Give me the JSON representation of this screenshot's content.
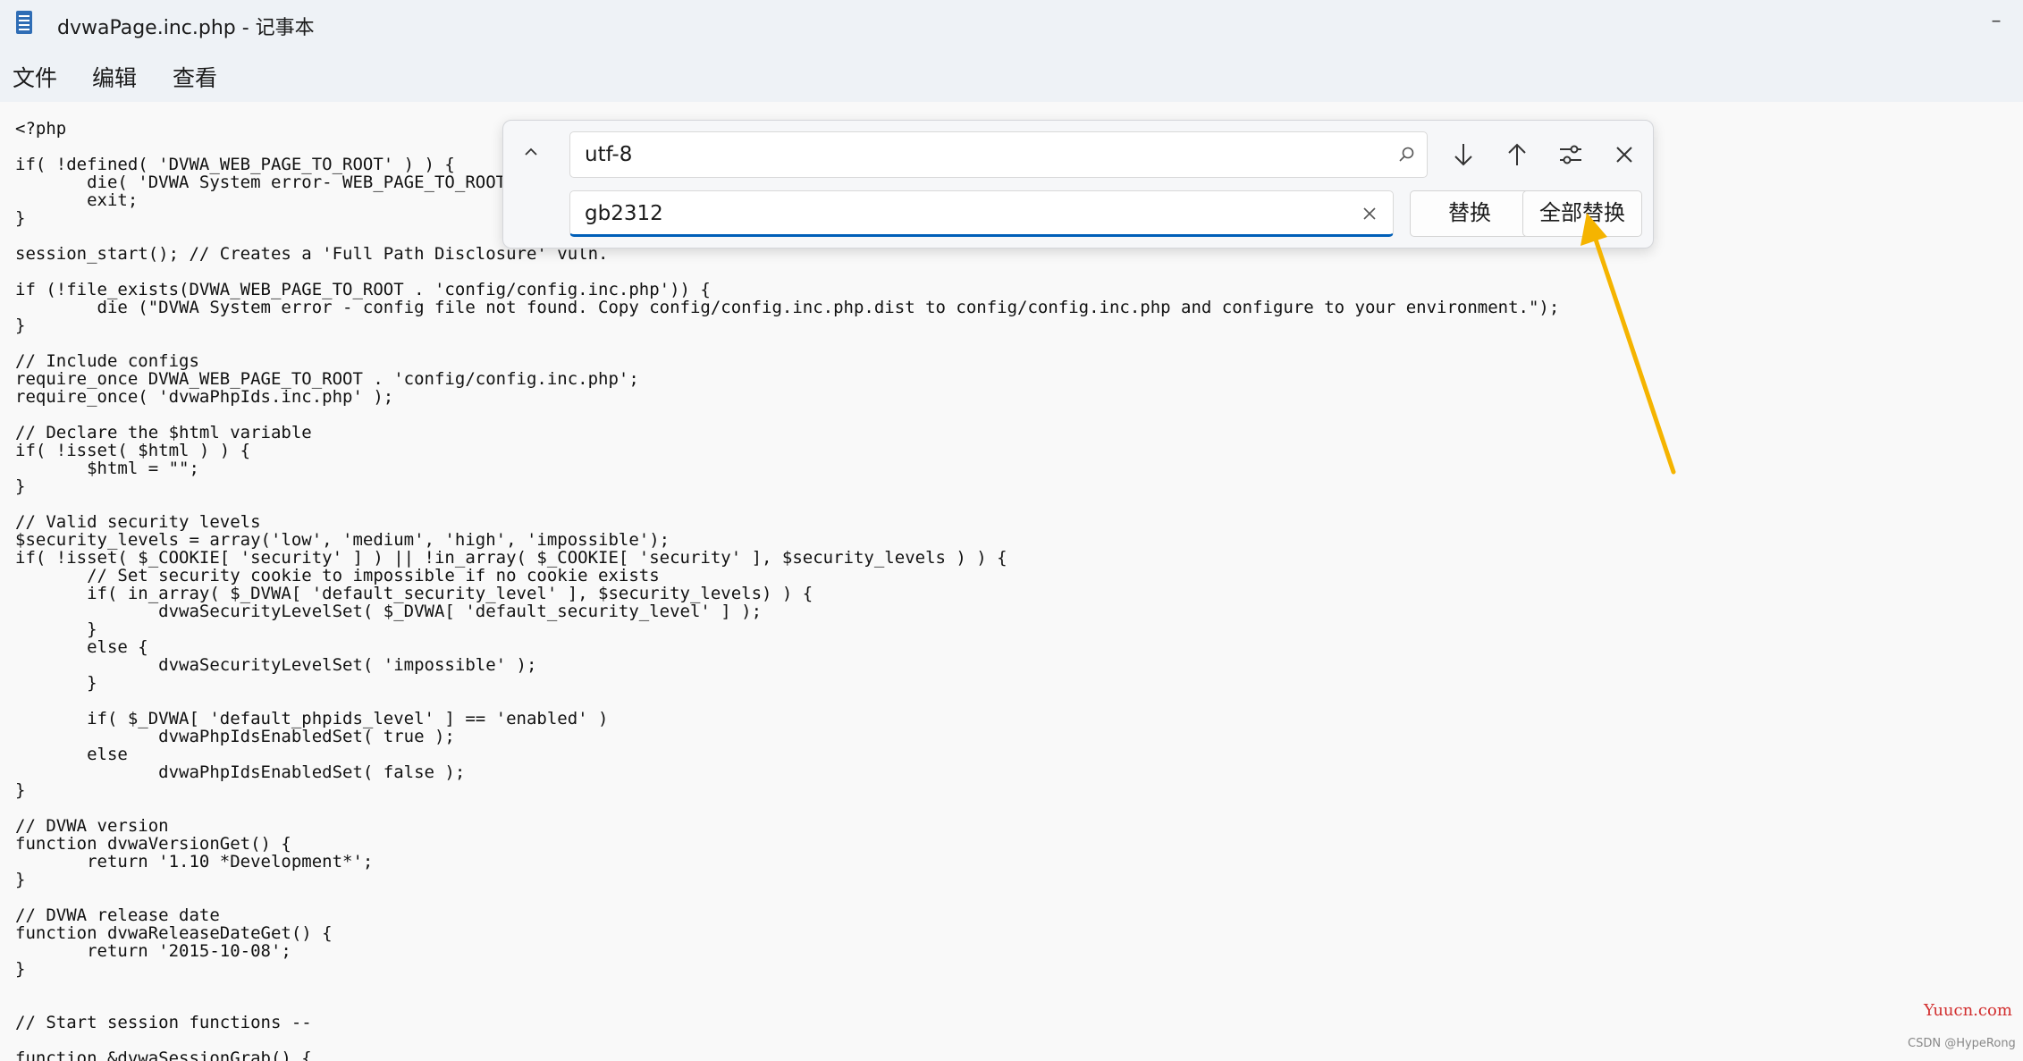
{
  "window": {
    "title": "dvwaPage.inc.php - 记事本",
    "minimize_glyph": "–"
  },
  "menu": {
    "items": [
      "文件",
      "编辑",
      "查看"
    ]
  },
  "find_replace": {
    "find_value": "utf-8",
    "replace_value": "gb2312",
    "replace_label": "替换",
    "replace_all_label": "全部替换",
    "icons": [
      "chevron-up-icon",
      "search-icon",
      "clear-icon",
      "arrow-down-icon",
      "arrow-up-icon",
      "options-icon",
      "close-icon"
    ]
  },
  "editor": {
    "lines": [
      "<?php",
      "",
      "if( !defined( 'DVWA_WEB_PAGE_TO_ROOT' ) ) {",
      "       die( 'DVWA System error- WEB_PAGE_TO_ROOT undefined' );",
      "       exit;",
      "}",
      "",
      "session_start(); // Creates a 'Full Path Disclosure' vuln.",
      "",
      "if (!file_exists(DVWA_WEB_PAGE_TO_ROOT . 'config/config.inc.php')) {",
      "        die (\"DVWA System error - config file not found. Copy config/config.inc.php.dist to config/config.inc.php and configure to your environment.\");",
      "}",
      "",
      "// Include configs",
      "require_once DVWA_WEB_PAGE_TO_ROOT . 'config/config.inc.php';",
      "require_once( 'dvwaPhpIds.inc.php' );",
      "",
      "// Declare the $html variable",
      "if( !isset( $html ) ) {",
      "       $html = \"\";",
      "}",
      "",
      "// Valid security levels",
      "$security_levels = array('low', 'medium', 'high', 'impossible');",
      "if( !isset( $_COOKIE[ 'security' ] ) || !in_array( $_COOKIE[ 'security' ], $security_levels ) ) {",
      "       // Set security cookie to impossible if no cookie exists",
      "       if( in_array( $_DVWA[ 'default_security_level' ], $security_levels) ) {",
      "              dvwaSecurityLevelSet( $_DVWA[ 'default_security_level' ] );",
      "       }",
      "       else {",
      "              dvwaSecurityLevelSet( 'impossible' );",
      "       }",
      "",
      "       if( $_DVWA[ 'default_phpids_level' ] == 'enabled' )",
      "              dvwaPhpIdsEnabledSet( true );",
      "       else",
      "              dvwaPhpIdsEnabledSet( false );",
      "}",
      "",
      "// DVWA version",
      "function dvwaVersionGet() {",
      "       return '1.10 *Development*';",
      "}",
      "",
      "// DVWA release date",
      "function dvwaReleaseDateGet() {",
      "       return '2015-10-08';",
      "}",
      "",
      "",
      "// Start session functions --",
      "",
      "function &dvwaSessionGrab() {"
    ]
  },
  "watermark": {
    "brand": "Yuucn.com",
    "credit": "CSDN @HypeRong"
  },
  "colors": {
    "accent": "#005fb8",
    "annotation_arrow": "#f5b400",
    "brand_red": "#d22e2e"
  }
}
